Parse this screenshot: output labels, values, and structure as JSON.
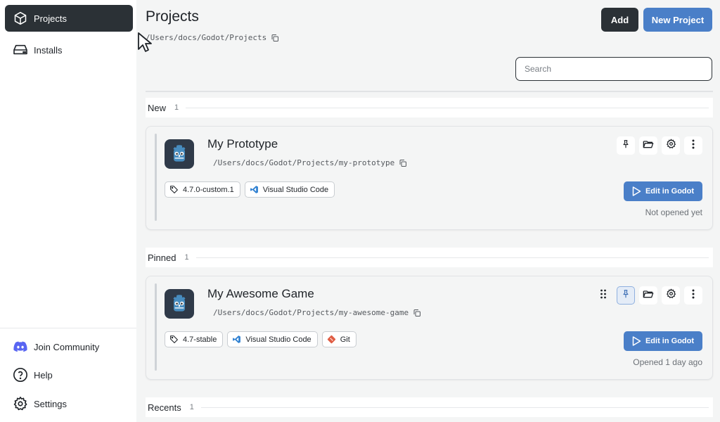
{
  "sidebar": {
    "items": [
      {
        "label": "Projects",
        "icon": "box-icon"
      },
      {
        "label": "Installs",
        "icon": "drive-icon"
      }
    ],
    "bottom": [
      {
        "label": "Join Community",
        "icon": "discord-icon"
      },
      {
        "label": "Help",
        "icon": "help-icon"
      },
      {
        "label": "Settings",
        "icon": "gear-icon"
      }
    ]
  },
  "header": {
    "title": "Projects",
    "path": "/Users/docs/Godot/Projects",
    "add_label": "Add",
    "new_project_label": "New Project"
  },
  "search": {
    "placeholder": "Search",
    "value": ""
  },
  "sections": [
    {
      "label": "New",
      "count": "1"
    },
    {
      "label": "Pinned",
      "count": "1"
    },
    {
      "label": "Recents",
      "count": "1"
    }
  ],
  "projects": [
    {
      "name": "My Prototype",
      "path": "/Users/docs/Godot/Projects/my-prototype",
      "tags": [
        "4.7.0-custom.1",
        "Visual Studio Code"
      ],
      "edit_label": "Edit in Godot",
      "opened": "Not opened yet"
    },
    {
      "name": "My Awesome Game",
      "path": "/Users/docs/Godot/Projects/my-awesome-game",
      "tags": [
        "4.7-stable",
        "Visual Studio Code",
        "Git"
      ],
      "edit_label": "Edit in Godot",
      "opened": "Opened 1 day ago"
    }
  ],
  "colors": {
    "accent": "#4a7fc8",
    "dark": "#2b3136",
    "vscode": "#2f80d1",
    "git": "#e05d44"
  }
}
